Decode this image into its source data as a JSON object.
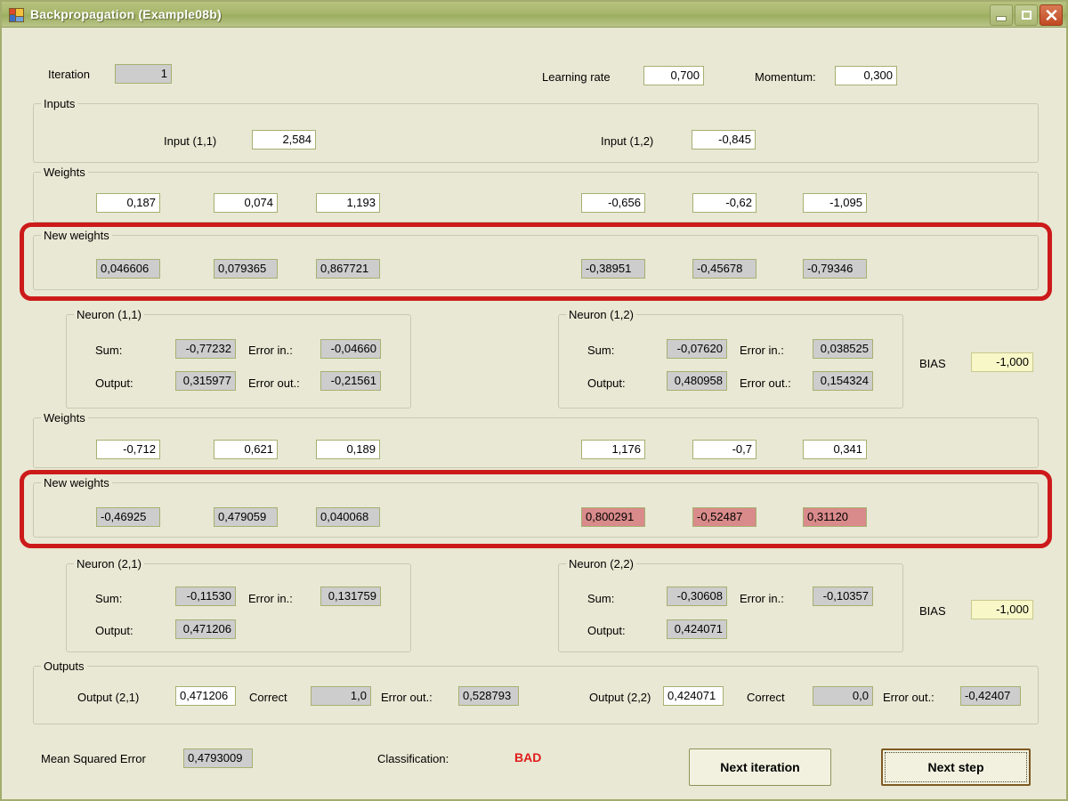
{
  "window": {
    "title": "Backpropagation (Example08b)",
    "icon": "form-icon",
    "buttons": {
      "minimize": "minimize-button",
      "maximize": "maximize-button",
      "close": "close-button"
    }
  },
  "top": {
    "iteration_label": "Iteration",
    "iteration_value": "1",
    "learning_rate_label": "Learning rate",
    "learning_rate_value": "0,700",
    "momentum_label": "Momentum:",
    "momentum_value": "0,300"
  },
  "inputs": {
    "caption": "Inputs",
    "in11_label": "Input (1,1)",
    "in11_value": "2,584",
    "in12_label": "Input (1,2)",
    "in12_value": "-0,845"
  },
  "weights1": {
    "caption": "Weights",
    "values": [
      "0,187",
      "0,074",
      "1,193",
      "-0,656",
      "-0,62",
      "-1,095"
    ]
  },
  "new_weights1": {
    "caption": "New weights",
    "values": [
      "0,046606",
      "0,079365",
      "0,867721",
      "-0,38951",
      "-0,45678",
      "-0,79346"
    ],
    "highlighted": [
      false,
      false,
      false,
      false,
      false,
      false
    ]
  },
  "neuron11": {
    "caption": "Neuron (1,1)",
    "sum_label": "Sum:",
    "sum_value": "-0,77232",
    "errin_label": "Error in.:",
    "errin_value": "-0,04660",
    "out_label": "Output:",
    "out_value": "0,315977",
    "errout_label": "Error out.:",
    "errout_value": "-0,21561"
  },
  "neuron12": {
    "caption": "Neuron (1,2)",
    "sum_label": "Sum:",
    "sum_value": "-0,07620",
    "errin_label": "Error in.:",
    "errin_value": "0,038525",
    "out_label": "Output:",
    "out_value": "0,480958",
    "errout_label": "Error out.:",
    "errout_value": "0,154324"
  },
  "bias1": {
    "label": "BIAS",
    "value": "-1,000"
  },
  "weights2": {
    "caption": "Weights",
    "values": [
      "-0,712",
      "0,621",
      "0,189",
      "1,176",
      "-0,7",
      "0,341"
    ]
  },
  "new_weights2": {
    "caption": "New weights",
    "values": [
      "-0,46925",
      "0,479059",
      "0,040068",
      "0,800291",
      "-0,52487",
      "0,31120"
    ],
    "highlighted": [
      false,
      false,
      false,
      true,
      true,
      true
    ]
  },
  "neuron21": {
    "caption": "Neuron (2,1)",
    "sum_label": "Sum:",
    "sum_value": "-0,11530",
    "errin_label": "Error in.:",
    "errin_value": "0,131759",
    "out_label": "Output:",
    "out_value": "0,471206"
  },
  "neuron22": {
    "caption": "Neuron (2,2)",
    "sum_label": "Sum:",
    "sum_value": "-0,30608",
    "errin_label": "Error in.:",
    "errin_value": "-0,10357",
    "out_label": "Output:",
    "out_value": "0,424071"
  },
  "bias2": {
    "label": "BIAS",
    "value": "-1,000"
  },
  "outputs": {
    "caption": "Outputs",
    "o21_label": "Output (2,1)",
    "o21_value": "0,471206",
    "c21_label": "Correct",
    "c21_value": "1,0",
    "e21_label": "Error out.:",
    "e21_value": "0,528793",
    "o22_label": "Output (2,2)",
    "o22_value": "0,424071",
    "c22_label": "Correct",
    "c22_value": "0,0",
    "e22_label": "Error out.:",
    "e22_value": "-0,42407"
  },
  "footer": {
    "mse_label": "Mean Squared Error",
    "mse_value": "0,4793009",
    "classification_label": "Classification:",
    "classification_value": "BAD",
    "next_iteration": "Next iteration",
    "next_step": "Next step"
  },
  "colors": {
    "accent": "#a3ad6e",
    "highlight_red": "#cc1a1a",
    "bad_cell": "#d98a8a",
    "bias": "#f7f7c8",
    "classification": "#e01b1b"
  }
}
